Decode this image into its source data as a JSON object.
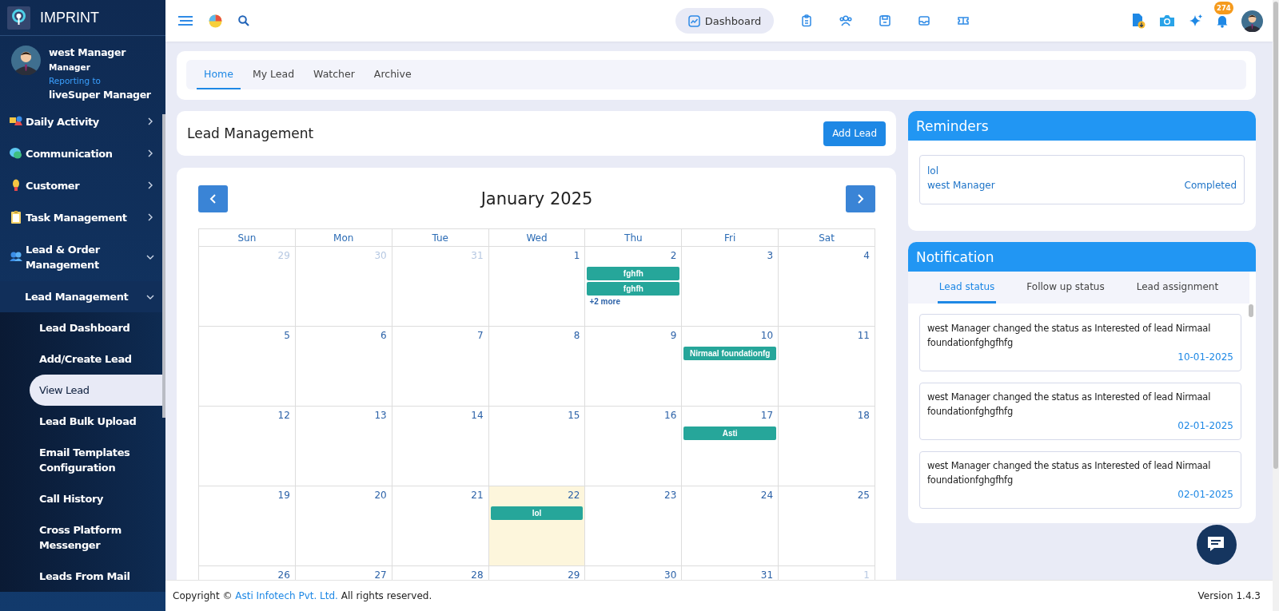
{
  "brand": {
    "name": "IMPRINT"
  },
  "user": {
    "name": "west Manager",
    "role": "Manager",
    "reporting_label": "Reporting to",
    "reports_to": "liveSuper Manager"
  },
  "sidebar": {
    "items": [
      {
        "label": "Daily Activity",
        "expanded": false
      },
      {
        "label": "Communication",
        "expanded": false
      },
      {
        "label": "Customer",
        "expanded": false
      },
      {
        "label": "Task Management",
        "expanded": false
      },
      {
        "label": "Lead & Order Management",
        "expanded": true,
        "children": [
          {
            "label": "Lead Management",
            "expanded": true,
            "children": [
              {
                "label": "Lead Dashboard",
                "selected": false
              },
              {
                "label": "Add/Create Lead",
                "selected": false
              },
              {
                "label": "View Lead",
                "selected": true
              },
              {
                "label": "Lead Bulk Upload",
                "selected": false
              },
              {
                "label": "Email Templates Configuration",
                "selected": false
              },
              {
                "label": "Call History",
                "selected": false
              },
              {
                "label": "Cross Platform Messenger",
                "selected": false
              },
              {
                "label": "Leads From Mail",
                "selected": false
              }
            ]
          }
        ]
      }
    ]
  },
  "topbar": {
    "dashboard_button": "Dashboard",
    "notification_count": "274"
  },
  "page_tabs": [
    {
      "label": "Home",
      "selected": true
    },
    {
      "label": "My Lead",
      "selected": false
    },
    {
      "label": "Watcher",
      "selected": false
    },
    {
      "label": "Archive",
      "selected": false
    }
  ],
  "header": {
    "title": "Lead Management",
    "button": "Add Lead"
  },
  "calendar": {
    "title": "January 2025",
    "weekdays": [
      "Sun",
      "Mon",
      "Tue",
      "Wed",
      "Thu",
      "Fri",
      "Sat"
    ],
    "weeks": [
      [
        {
          "day": "29",
          "outside": true,
          "today": false
        },
        {
          "day": "30",
          "outside": true,
          "today": false
        },
        {
          "day": "31",
          "outside": true,
          "today": false
        },
        {
          "day": "1",
          "outside": false,
          "today": false
        },
        {
          "day": "2",
          "outside": false,
          "today": false,
          "events": [
            "fghfh",
            "fghfh"
          ],
          "more": "+2 more"
        },
        {
          "day": "3",
          "outside": false,
          "today": false
        },
        {
          "day": "4",
          "outside": false,
          "today": false
        }
      ],
      [
        {
          "day": "5",
          "outside": false,
          "today": false
        },
        {
          "day": "6",
          "outside": false,
          "today": false
        },
        {
          "day": "7",
          "outside": false,
          "today": false
        },
        {
          "day": "8",
          "outside": false,
          "today": false
        },
        {
          "day": "9",
          "outside": false,
          "today": false
        },
        {
          "day": "10",
          "outside": false,
          "today": false,
          "events": [
            "Nirmaal foundationfg"
          ]
        },
        {
          "day": "11",
          "outside": false,
          "today": false
        }
      ],
      [
        {
          "day": "12",
          "outside": false,
          "today": false
        },
        {
          "day": "13",
          "outside": false,
          "today": false
        },
        {
          "day": "14",
          "outside": false,
          "today": false
        },
        {
          "day": "15",
          "outside": false,
          "today": false
        },
        {
          "day": "16",
          "outside": false,
          "today": false
        },
        {
          "day": "17",
          "outside": false,
          "today": false,
          "events": [
            "Asti"
          ]
        },
        {
          "day": "18",
          "outside": false,
          "today": false
        }
      ],
      [
        {
          "day": "19",
          "outside": false,
          "today": false
        },
        {
          "day": "20",
          "outside": false,
          "today": false
        },
        {
          "day": "21",
          "outside": false,
          "today": false
        },
        {
          "day": "22",
          "outside": false,
          "today": true,
          "events": [
            "lol"
          ]
        },
        {
          "day": "23",
          "outside": false,
          "today": false
        },
        {
          "day": "24",
          "outside": false,
          "today": false
        },
        {
          "day": "25",
          "outside": false,
          "today": false
        }
      ],
      [
        {
          "day": "26",
          "outside": false,
          "today": false
        },
        {
          "day": "27",
          "outside": false,
          "today": false
        },
        {
          "day": "28",
          "outside": false,
          "today": false
        },
        {
          "day": "29",
          "outside": false,
          "today": false
        },
        {
          "day": "30",
          "outside": false,
          "today": false
        },
        {
          "day": "31",
          "outside": false,
          "today": false
        },
        {
          "day": "1",
          "outside": true,
          "today": false
        }
      ]
    ]
  },
  "reminders": {
    "title": "Reminders",
    "items": [
      {
        "title": "lol",
        "owner": "west Manager",
        "status": "Completed"
      }
    ]
  },
  "notifications": {
    "title": "Notification",
    "tabs": [
      {
        "label": "Lead status",
        "selected": true
      },
      {
        "label": "Follow up status",
        "selected": false
      },
      {
        "label": "Lead assignment",
        "selected": false
      }
    ],
    "items": [
      {
        "text": "west Manager changed the status as Interested of lead Nirmaal foundationfghgfhfg",
        "date": "10-01-2025"
      },
      {
        "text": "west Manager changed the status as Interested of lead Nirmaal foundationfghgfhfg",
        "date": "02-01-2025"
      },
      {
        "text": "west Manager changed the status as Interested of lead Nirmaal foundationfghgfhfg",
        "date": "02-01-2025"
      }
    ]
  },
  "footer": {
    "copyright": "Copyright ©",
    "company": "Asti Infotech Pvt. Ltd.",
    "rights": "All rights reserved.",
    "version": "Version 1.4.3"
  }
}
